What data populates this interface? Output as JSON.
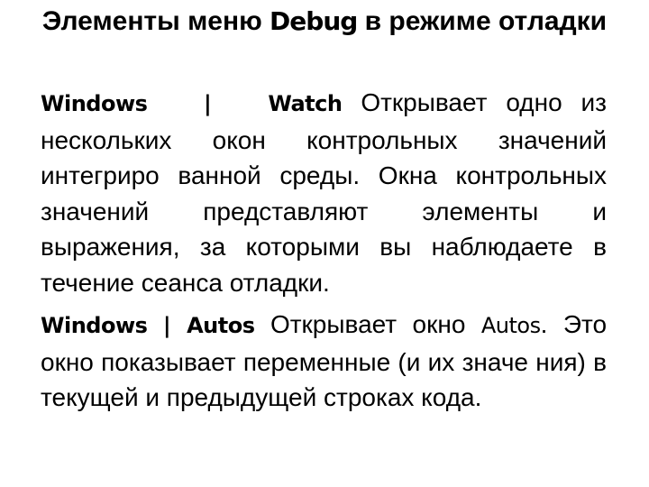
{
  "slide": {
    "title": {
      "part1": "Элементы меню ",
      "debug_word": "Debug",
      "part2": " в режиме отладки"
    },
    "paragraphs": [
      {
        "command_menu": "Windows",
        "separator": "|",
        "command_item": "Watch",
        "text": "Открывает одно из нескольких окон контрольных значений интегриро ванной среды. Окна контрольных значений представляют элементы и выражения, за которыми вы наблюдаете в течение сеанса отладки."
      },
      {
        "command_menu": "Windows",
        "separator": "|",
        "command_item": "Autos",
        "text_before": "Открывает окно ",
        "window_name": "Autos",
        "text_after": ". Это окно показывает переменные (и их значе ния) в текущей и предыдущей строках кода."
      }
    ]
  }
}
